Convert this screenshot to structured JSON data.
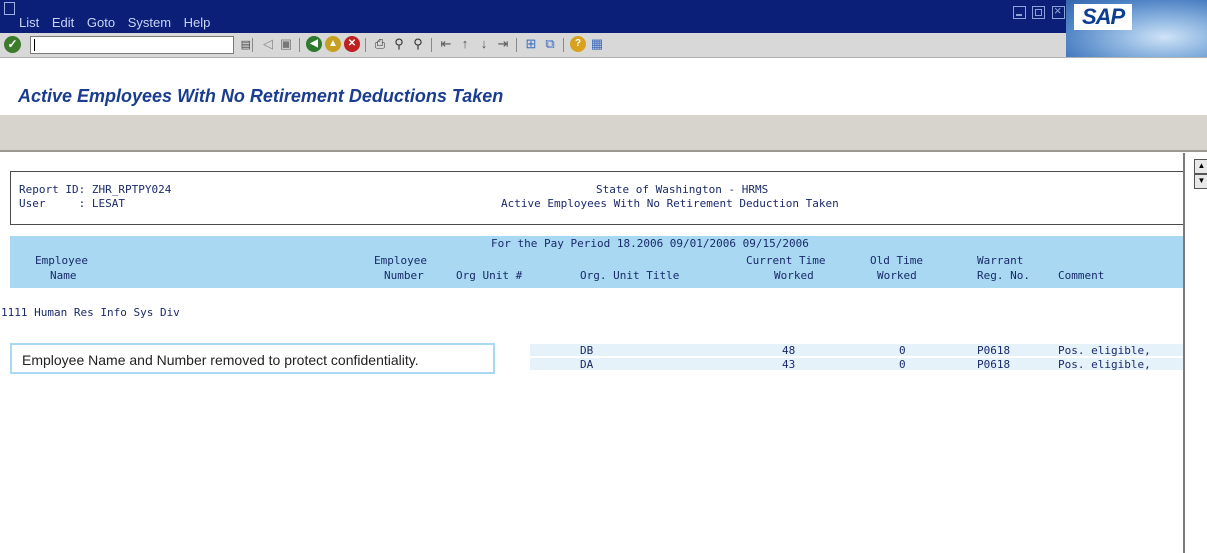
{
  "menu": {
    "items": [
      "List",
      "Edit",
      "Goto",
      "System",
      "Help"
    ]
  },
  "branding": {
    "logo_text": "SAP"
  },
  "toolbar": {
    "command_value": "",
    "icons": [
      "enter-icon",
      "history-icon",
      "back-arrow-icon",
      "save-icon",
      "back-icon",
      "exit-icon",
      "cancel-icon",
      "print-icon",
      "find-icon",
      "find-next-icon",
      "first-page-icon",
      "previous-page-icon",
      "next-page-icon",
      "last-page-icon",
      "create-session-icon",
      "shortcut-icon",
      "help-icon",
      "layout-icon"
    ]
  },
  "page": {
    "title": "Active Employees With No Retirement Deductions Taken"
  },
  "report": {
    "header": {
      "report_id": "Report ID: ZHR_RPTPY024",
      "user": "User     : LESAT",
      "org": "State of Washington - HRMS",
      "subtitle": "Active Employees With No Retirement Deduction Taken"
    },
    "period": "For the Pay Period 18.2006 09/01/2006 09/15/2006",
    "columns": {
      "emp_name_1": "Employee",
      "emp_name_2": "Name",
      "emp_num_1": "Employee",
      "emp_num_2": "Number",
      "org_unit": "Org Unit #",
      "org_title": "Org. Unit Title",
      "cur_time_1": "Current Time",
      "cur_time_2": "Worked",
      "old_time_1": "Old Time",
      "old_time_2": "Worked",
      "warrant_1": "Warrant",
      "warrant_2": "Reg. No.",
      "comment": "Comment"
    },
    "group_label": "1111 Human Res Info Sys Div",
    "confidential_note": "Employee Name and Number removed to protect confidentiality.",
    "rows": [
      {
        "org_title": "DB",
        "current": "48",
        "old": "0",
        "warrant": "P0618",
        "comment": "Pos. eligible,"
      },
      {
        "org_title": "DA",
        "current": "43",
        "old": "0",
        "warrant": "P0618",
        "comment": "Pos. eligible,"
      }
    ]
  },
  "colors": {
    "menubar": "#0b1f78",
    "title": "#1a3d8f",
    "column_header_bg": "#a8d8f2",
    "row_bg": "#e6f2fa"
  }
}
